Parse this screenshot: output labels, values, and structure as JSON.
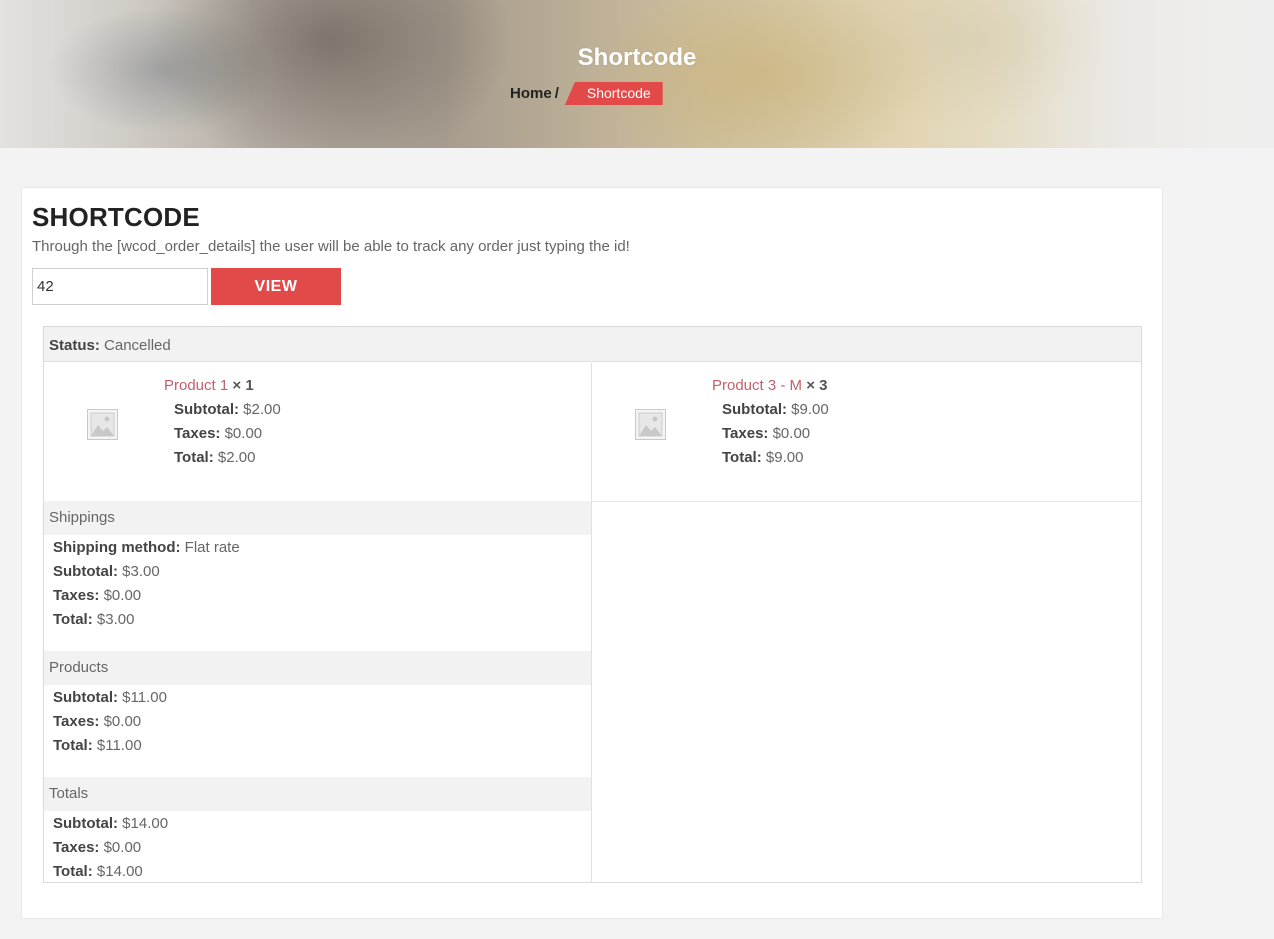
{
  "hero": {
    "title": "Shortcode",
    "breadcrumb": {
      "home": "Home",
      "separator": "/",
      "current": "Shortcode"
    }
  },
  "main": {
    "title": "SHORTCODE",
    "description": "Through the [wcod_order_details] the user will be able to track any order just typing the id!",
    "order_input_value": "42",
    "view_button": "VIEW"
  },
  "order": {
    "status_label": "Status:",
    "status_value": "Cancelled",
    "items": [
      {
        "name": "Product 1",
        "qty": "× 1",
        "image_icon": "placeholder-image-icon",
        "subtotal_label": "Subtotal:",
        "subtotal": "$2.00",
        "taxes_label": "Taxes:",
        "taxes": "$0.00",
        "total_label": "Total:",
        "total": "$2.00"
      },
      {
        "name": "Product 3 - M",
        "qty": "× 3",
        "image_icon": "placeholder-image-icon",
        "subtotal_label": "Subtotal:",
        "subtotal": "$9.00",
        "taxes_label": "Taxes:",
        "taxes": "$0.00",
        "total_label": "Total:",
        "total": "$9.00"
      }
    ],
    "shippings": {
      "heading": "Shippings",
      "method_label": "Shipping method:",
      "method": "Flat rate",
      "subtotal_label": "Subtotal:",
      "subtotal": "$3.00",
      "taxes_label": "Taxes:",
      "taxes": "$0.00",
      "total_label": "Total:",
      "total": "$3.00"
    },
    "products": {
      "heading": "Products",
      "subtotal_label": "Subtotal:",
      "subtotal": "$11.00",
      "taxes_label": "Taxes:",
      "taxes": "$0.00",
      "total_label": "Total:",
      "total": "$11.00"
    },
    "totals": {
      "heading": "Totals",
      "subtotal_label": "Subtotal:",
      "subtotal": "$14.00",
      "taxes_label": "Taxes:",
      "taxes": "$0.00",
      "total_label": "Total:",
      "total": "$14.00"
    }
  },
  "colors": {
    "accent": "#e24a4a",
    "link": "#c0616c",
    "page_bg": "#f3f3f3",
    "section_bg": "#f2f2f2"
  }
}
